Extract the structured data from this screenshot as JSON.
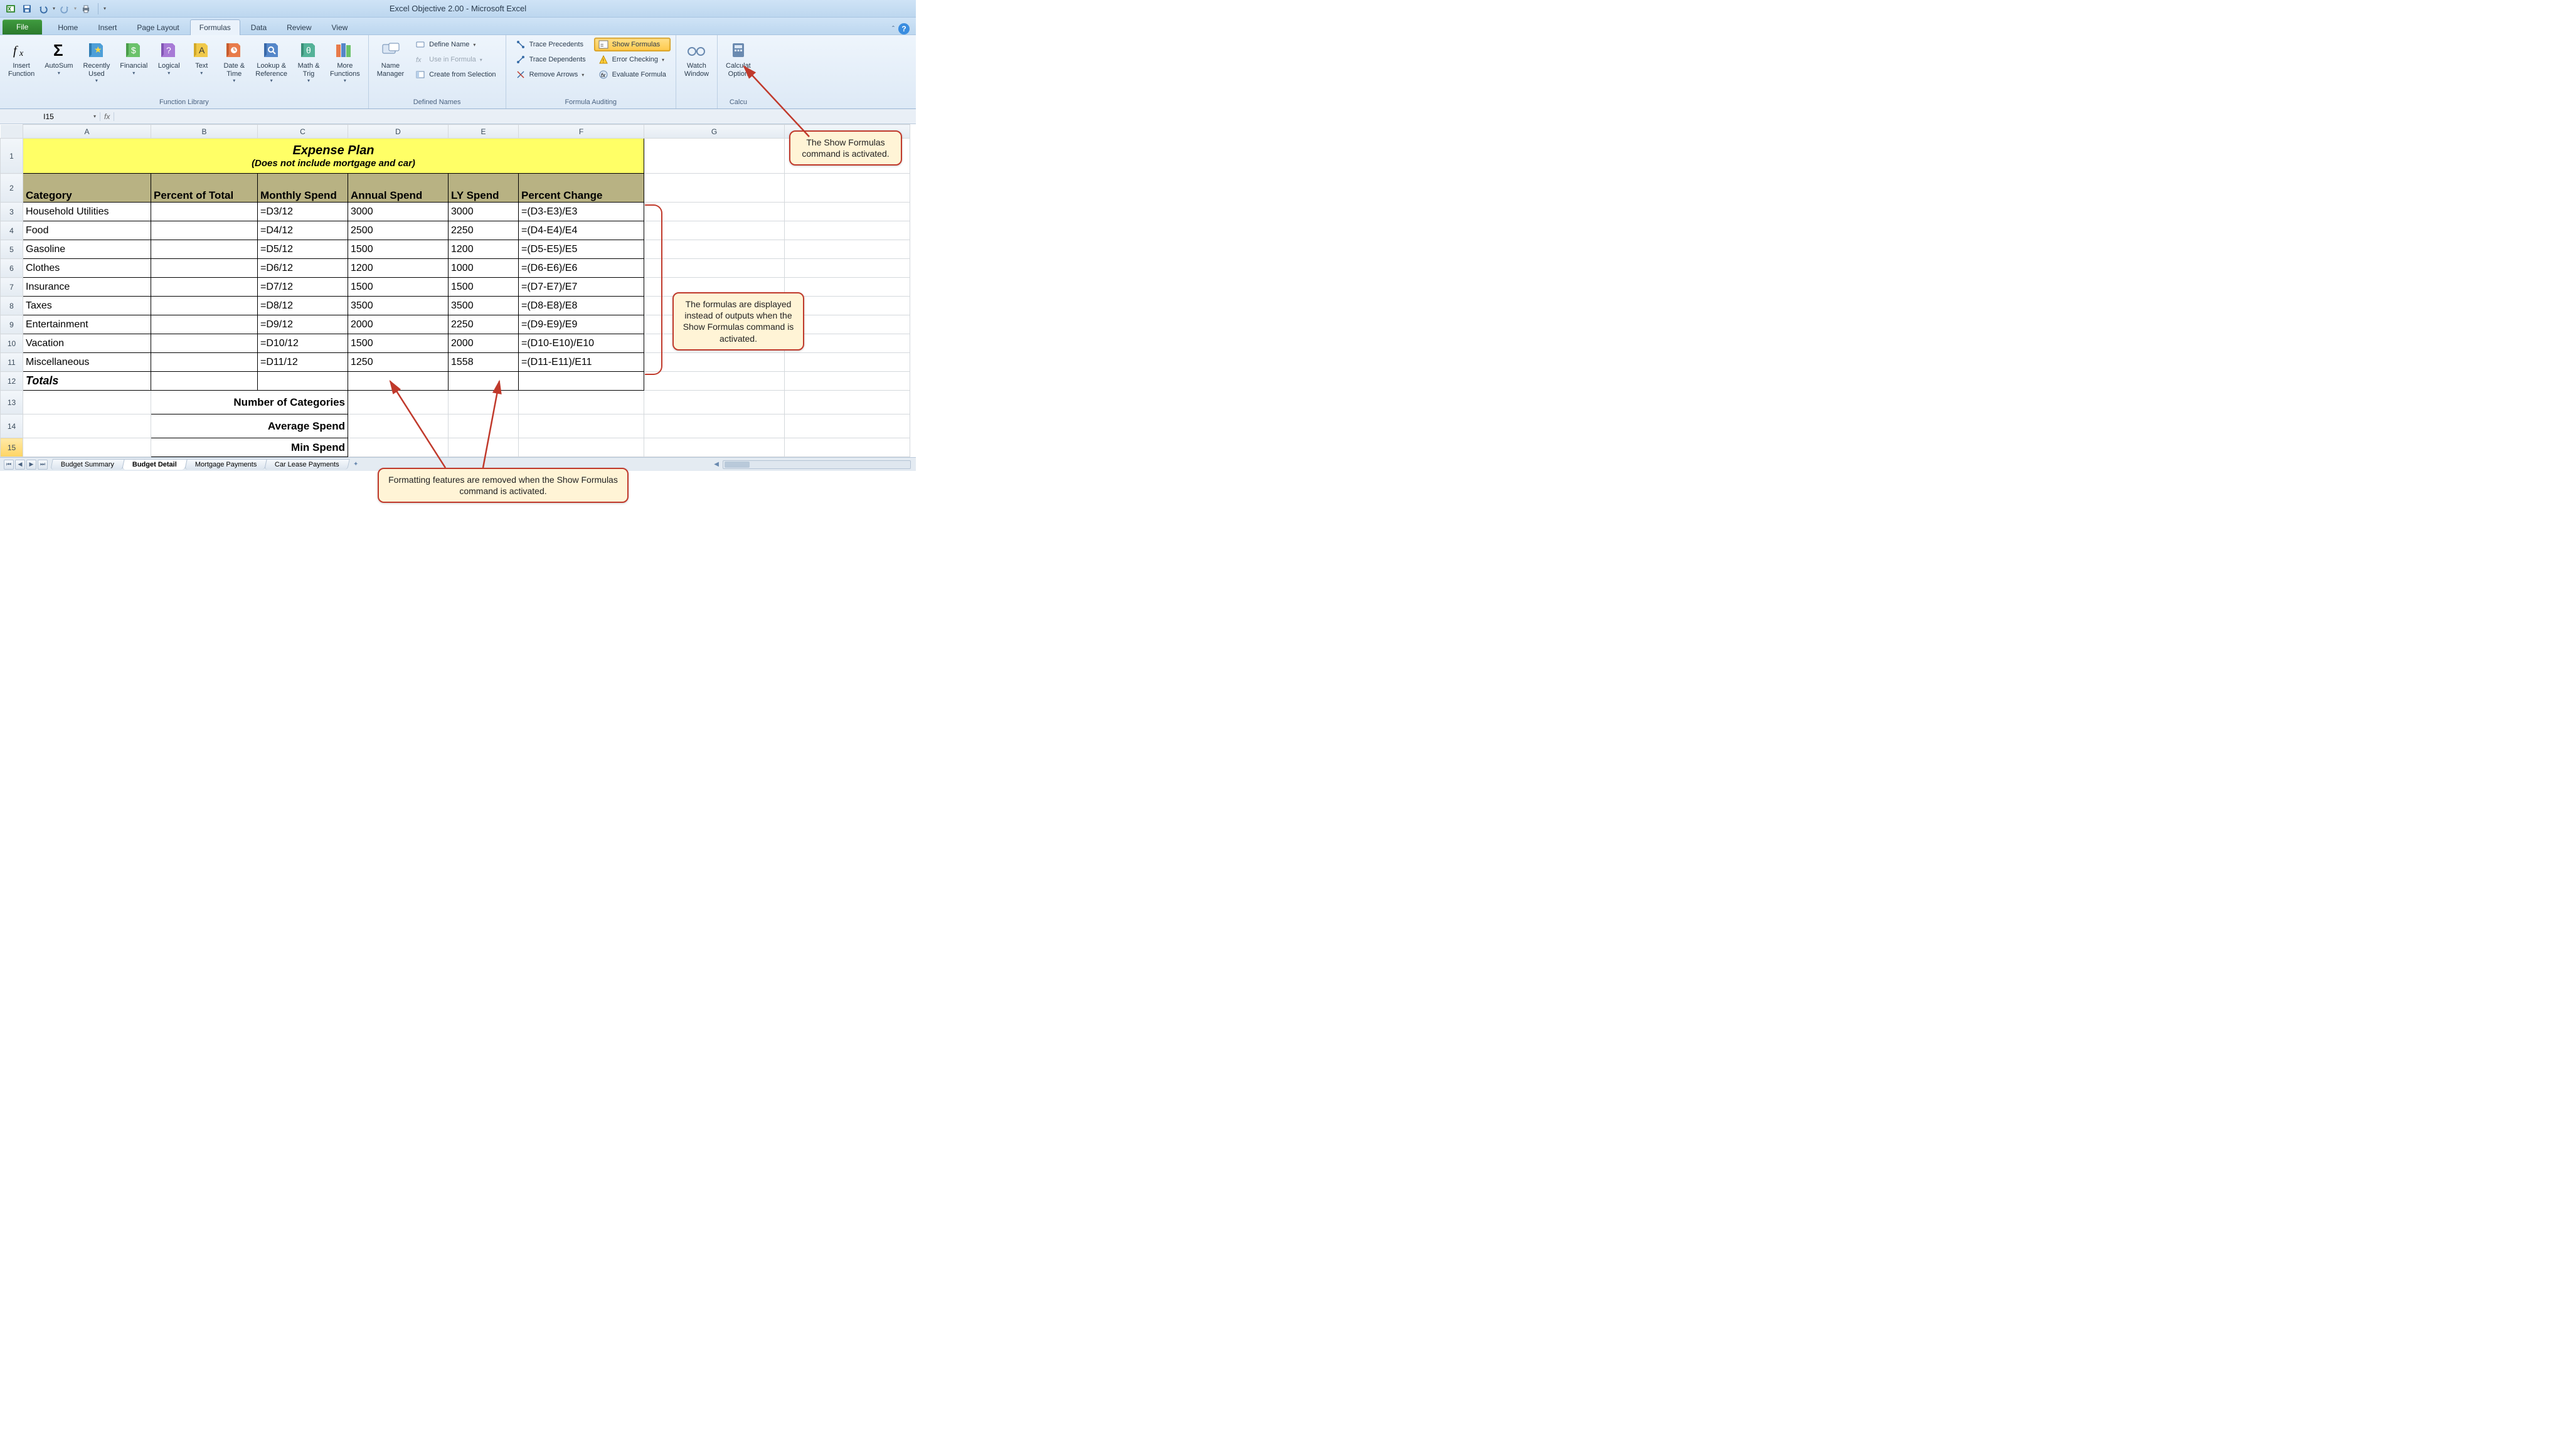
{
  "window": {
    "title": "Excel Objective 2.00 - Microsoft Excel"
  },
  "qat": {
    "excel_icon": "excel-icon",
    "save_icon": "save-icon",
    "undo_icon": "undo-icon",
    "redo_icon": "redo-icon",
    "print_icon": "print-icon"
  },
  "tabs": {
    "file": "File",
    "items": [
      "Home",
      "Insert",
      "Page Layout",
      "Formulas",
      "Data",
      "Review",
      "View"
    ],
    "active": "Formulas"
  },
  "ribbon": {
    "function_library": {
      "label": "Function Library",
      "insert_function": "Insert\nFunction",
      "autosum": "AutoSum",
      "recently_used": "Recently\nUsed",
      "financial": "Financial",
      "logical": "Logical",
      "text": "Text",
      "date_time": "Date &\nTime",
      "lookup_ref": "Lookup &\nReference",
      "math_trig": "Math &\nTrig",
      "more_functions": "More\nFunctions"
    },
    "defined_names": {
      "label": "Defined Names",
      "name_manager": "Name\nManager",
      "define_name": "Define Name",
      "use_in_formula": "Use in Formula",
      "create_from_selection": "Create from Selection"
    },
    "formula_auditing": {
      "label": "Formula Auditing",
      "trace_precedents": "Trace Precedents",
      "trace_dependents": "Trace Dependents",
      "remove_arrows": "Remove Arrows",
      "show_formulas": "Show Formulas",
      "error_checking": "Error Checking",
      "evaluate_formula": "Evaluate Formula"
    },
    "watch": {
      "label": "",
      "watch_window": "Watch\nWindow"
    },
    "calc": {
      "label": "Calcu",
      "calc_options": "Calculat\nOption"
    }
  },
  "formula_bar": {
    "name_box": "I15",
    "fx": "fx",
    "formula": ""
  },
  "columns": [
    "A",
    "B",
    "C",
    "D",
    "E",
    "F",
    "G"
  ],
  "sheet": {
    "title": "Expense Plan",
    "subtitle": "(Does not include mortgage and car)",
    "headers": {
      "category": "Category",
      "percent_of_total": "Percent of Total",
      "monthly_spend": "Monthly Spend",
      "annual_spend": "Annual Spend",
      "ly_spend": "LY Spend",
      "percent_change": "Percent Change"
    },
    "rows": [
      {
        "n": "3",
        "cat": "Household Utilities",
        "b": "",
        "c": "=D3/12",
        "d": "3000",
        "e": "3000",
        "f": "=(D3-E3)/E3"
      },
      {
        "n": "4",
        "cat": "Food",
        "b": "",
        "c": "=D4/12",
        "d": "2500",
        "e": "2250",
        "f": "=(D4-E4)/E4"
      },
      {
        "n": "5",
        "cat": "Gasoline",
        "b": "",
        "c": "=D5/12",
        "d": "1500",
        "e": "1200",
        "f": "=(D5-E5)/E5"
      },
      {
        "n": "6",
        "cat": "Clothes",
        "b": "",
        "c": "=D6/12",
        "d": "1200",
        "e": "1000",
        "f": "=(D6-E6)/E6"
      },
      {
        "n": "7",
        "cat": "Insurance",
        "b": "",
        "c": "=D7/12",
        "d": "1500",
        "e": "1500",
        "f": "=(D7-E7)/E7"
      },
      {
        "n": "8",
        "cat": "Taxes",
        "b": "",
        "c": "=D8/12",
        "d": "3500",
        "e": "3500",
        "f": "=(D8-E8)/E8"
      },
      {
        "n": "9",
        "cat": "Entertainment",
        "b": "",
        "c": "=D9/12",
        "d": "2000",
        "e": "2250",
        "f": "=(D9-E9)/E9"
      },
      {
        "n": "10",
        "cat": "Vacation",
        "b": "",
        "c": "=D10/12",
        "d": "1500",
        "e": "2000",
        "f": "=(D10-E10)/E10"
      },
      {
        "n": "11",
        "cat": "Miscellaneous",
        "b": "",
        "c": "=D11/12",
        "d": "1250",
        "e": "1558",
        "f": "=(D11-E11)/E11"
      }
    ],
    "totals_label": "Totals",
    "summary": {
      "num_categories": "Number of Categories",
      "average_spend": "Average Spend",
      "min_spend": "Min Spend"
    }
  },
  "sheet_tabs": {
    "items": [
      "Budget Summary",
      "Budget Detail",
      "Mortgage Payments",
      "Car Lease Payments"
    ],
    "active": "Budget Detail"
  },
  "callouts": {
    "c1": "The Show Formulas command is activated.",
    "c2": "The formulas are displayed instead of outputs when the Show Formulas command is activated.",
    "c3": "Formatting features are removed when the Show Formulas command is activated."
  }
}
